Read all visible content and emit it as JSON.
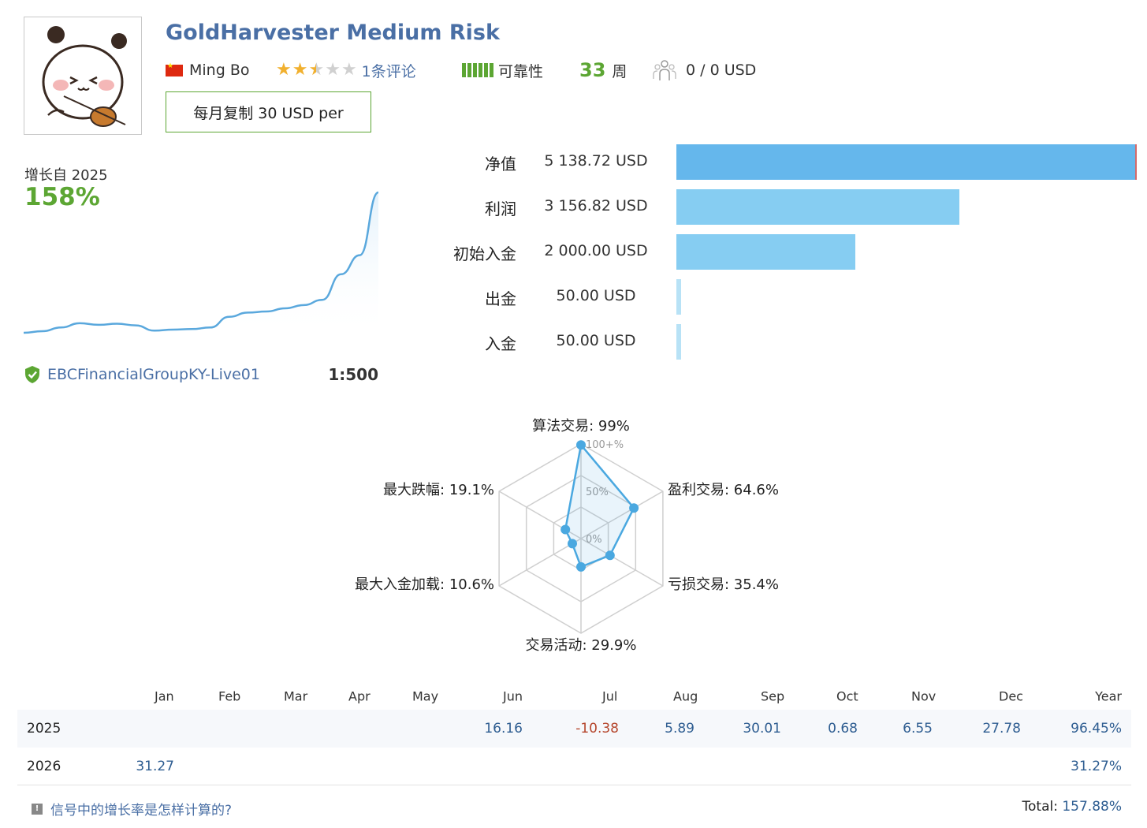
{
  "header": {
    "title": "GoldHarvester Medium Risk",
    "author": "Ming Bo",
    "rating_stars": 2.5,
    "reviews": "1条评论",
    "reliability_label": "可靠性",
    "weeks_value": "33",
    "weeks_unit": "周",
    "subscribers": "0 / 0 USD",
    "copy_button": "每月复制 30 USD per",
    "colors": {
      "accent": "#4a6fa5",
      "green": "#5ca633"
    }
  },
  "growth": {
    "label": "增长自 2025",
    "value": "158%",
    "series": [
      0,
      1.5,
      5,
      9,
      7.5,
      8.5,
      7,
      2,
      3,
      3.5,
      5,
      15,
      19,
      20,
      23,
      26,
      31,
      55,
      73,
      132
    ],
    "broker": "EBCFinancialGroupKY-Live01",
    "leverage": "1:500"
  },
  "balance": {
    "rows": [
      {
        "label": "净值",
        "value": "5 138.72 USD",
        "amount": 5138.72,
        "color": "#65b7ec"
      },
      {
        "label": "利润",
        "value": "3 156.82 USD",
        "amount": 3156.82,
        "color": "#86cdf2"
      },
      {
        "label": "初始入金",
        "value": "2 000.00 USD",
        "amount": 2000.0,
        "color": "#86cdf2"
      },
      {
        "label": "出金",
        "value": "50.00 USD",
        "amount": 50.0,
        "color": "#b8e2f6"
      },
      {
        "label": "入金",
        "value": "50.00 USD",
        "amount": 50.0,
        "color": "#b8e2f6"
      }
    ]
  },
  "radar": {
    "scale_labels": [
      "100+%",
      "50%",
      "0%"
    ],
    "axes": [
      {
        "label": "算法交易: 99%",
        "value": 99
      },
      {
        "label": "盈利交易: 64.6%",
        "value": 64.6
      },
      {
        "label": "亏损交易: 35.4%",
        "value": 35.4
      },
      {
        "label": "交易活动: 29.9%",
        "value": 29.9
      },
      {
        "label": "最大入金加载: 10.6%",
        "value": 10.6
      },
      {
        "label": "最大跌幅: 19.1%",
        "value": 19.1
      }
    ],
    "color": "#4aa8e0"
  },
  "monthly": {
    "headers": [
      "Jan",
      "Feb",
      "Mar",
      "Apr",
      "May",
      "Jun",
      "Jul",
      "Aug",
      "Sep",
      "Oct",
      "Nov",
      "Dec",
      "Year"
    ],
    "rows": [
      {
        "year": "2025",
        "values": [
          "",
          "",
          "",
          "",
          "",
          "16.16",
          "-10.38",
          "5.89",
          "30.01",
          "0.68",
          "6.55",
          "27.78",
          "96.45%"
        ]
      },
      {
        "year": "2026",
        "values": [
          "31.27",
          "",
          "",
          "",
          "",
          "",
          "",
          "",
          "",
          "",
          "",
          "",
          "31.27%"
        ]
      }
    ]
  },
  "footer": {
    "question": "信号中的增长率是怎样计算的?",
    "total_label": "Total:",
    "total_value": "157.88%"
  }
}
